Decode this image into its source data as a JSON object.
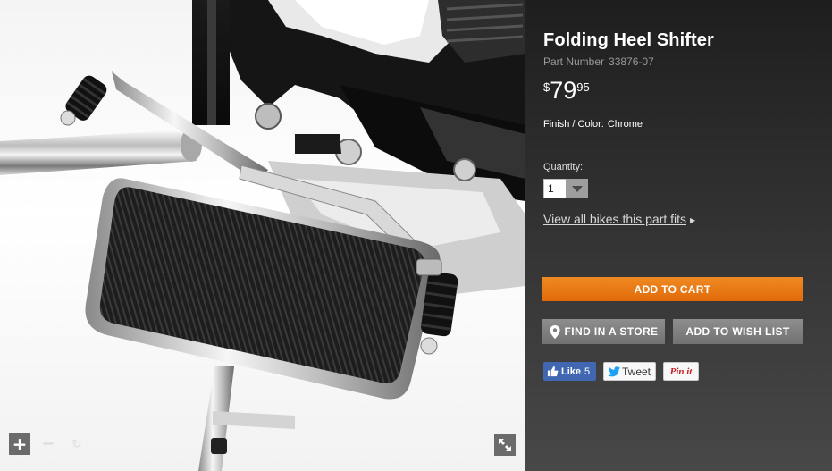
{
  "product": {
    "title": "Folding Heel Shifter",
    "part_number_label": "Part Number",
    "part_number": "33876-07",
    "price": {
      "currency_symbol": "$",
      "dollars": "79",
      "cents": "95"
    },
    "finish_label": "Finish / Color:",
    "finish_value": "Chrome"
  },
  "quantity": {
    "label": "Quantity:",
    "selected": "1"
  },
  "links": {
    "view_fits": "View all bikes this part fits"
  },
  "buttons": {
    "add_to_cart": "ADD TO CART",
    "find_in_store": "FIND IN A STORE",
    "add_to_wish_list": "ADD TO WISH LIST"
  },
  "social": {
    "like_label": "Like",
    "like_count": "5",
    "tweet_label": "Tweet",
    "pinit_label": "Pin it"
  },
  "image_viewer": {
    "zoom_in": "+",
    "zoom_out": "−",
    "reset": "↻"
  },
  "colors": {
    "accent_orange": "#e8770f",
    "panel_dark": "#2a2a2a",
    "facebook_blue": "#4267b2",
    "pinterest_red": "#cb2027"
  },
  "icons": [
    "plus-icon",
    "minus-icon",
    "reset-icon",
    "fullscreen-icon",
    "map-pin-icon",
    "chevron-down-icon",
    "caret-right-icon",
    "facebook-thumb-icon",
    "twitter-bird-icon"
  ]
}
